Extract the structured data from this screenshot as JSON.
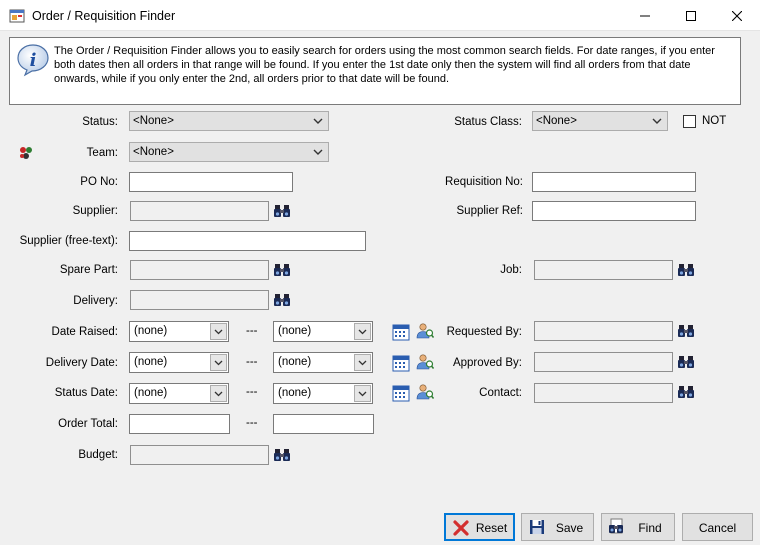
{
  "window": {
    "title": "Order / Requisition Finder",
    "app_icon": "app-window-icon",
    "minimize_icon": "minimize-icon",
    "maximize_icon": "maximize-icon",
    "close_icon": "close-icon"
  },
  "info": {
    "icon": "info-icon",
    "text": "The Order / Requisition Finder allows you to easily search for orders using the most common search fields. For date ranges, if you enter both dates then all orders in that range will be found. If you enter the 1st date only then the system will find all orders from that date onwards, while if you only enter the 2nd, all orders prior to that date will be found."
  },
  "form": {
    "status": {
      "label": "Status:",
      "value": "<None>"
    },
    "status_class": {
      "label": "Status Class:",
      "value": "<None>"
    },
    "not": {
      "label": "NOT",
      "checked": false
    },
    "team": {
      "label": "Team:",
      "value": "<None>"
    },
    "po_no": {
      "label": "PO No:",
      "value": ""
    },
    "requisition_no": {
      "label": "Requisition No:",
      "value": ""
    },
    "supplier": {
      "label": "Supplier:",
      "value": ""
    },
    "supplier_ref": {
      "label": "Supplier Ref:",
      "value": ""
    },
    "supplier_free_text": {
      "label": "Supplier (free-text):",
      "value": ""
    },
    "spare_part": {
      "label": "Spare Part:",
      "value": ""
    },
    "job": {
      "label": "Job:",
      "value": ""
    },
    "delivery": {
      "label": "Delivery:",
      "value": ""
    },
    "date_raised": {
      "label": "Date Raised:",
      "from": "(none)",
      "to": "(none)"
    },
    "delivery_date": {
      "label": "Delivery Date:",
      "from": "(none)",
      "to": "(none)"
    },
    "status_date": {
      "label": "Status Date:",
      "from": "(none)",
      "to": "(none)"
    },
    "requested_by": {
      "label": "Requested By:",
      "value": ""
    },
    "approved_by": {
      "label": "Approved By:",
      "value": ""
    },
    "contact": {
      "label": "Contact:",
      "value": ""
    },
    "order_total": {
      "label": "Order Total:",
      "from": "",
      "to": ""
    },
    "budget": {
      "label": "Budget:",
      "value": ""
    },
    "range_separator": "---"
  },
  "buttons": {
    "reset": "Reset",
    "save": "Save",
    "find": "Find",
    "cancel": "Cancel"
  },
  "colors": {
    "accent": "#0078d7",
    "reset_x": "#d32f2f"
  }
}
